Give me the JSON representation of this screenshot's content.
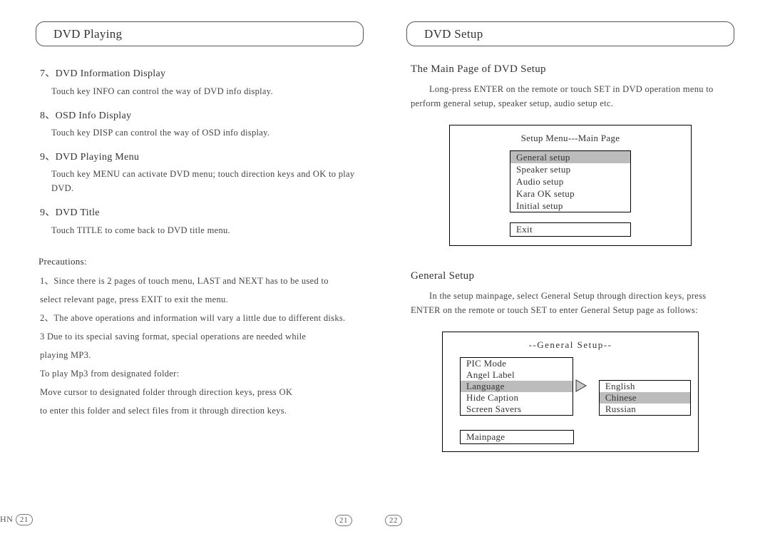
{
  "left": {
    "header": "DVD Playing",
    "items": [
      {
        "title": "7、DVD Information Display",
        "body": "Touch key INFO can control the way of DVD info display."
      },
      {
        "title": "8、OSD Info Display",
        "body": "Touch key DISP can control the way of OSD info display."
      },
      {
        "title": "9、DVD Playing Menu",
        "body": "Touch key MENU can activate DVD menu; touch direction keys and OK to play DVD."
      },
      {
        "title": "9、DVD Title",
        "body": "Touch TITLE to come back to DVD title menu."
      }
    ],
    "precautions_label": "Precautions:",
    "precautions": [
      "1、Since there is 2 pages of touch menu, LAST and NEXT has to be used to",
      "     select relevant page, press EXIT to exit the menu.",
      "2、The above operations and information will vary a little due to different disks.",
      "3    Due to its special saving format, special operations are needed while",
      "     playing MP3.",
      "     To play Mp3 from designated folder:",
      "     Move cursor to designated folder through direction keys, press OK",
      "     to enter this folder and select files from it through direction keys."
    ]
  },
  "right": {
    "header": "DVD Setup",
    "main_page": {
      "heading": "The Main Page of DVD Setup",
      "paragraph": "Long-press ENTER on the remote or touch SET in DVD operation menu to perform general setup, speaker setup, audio setup etc.",
      "menu_title": "Setup Menu---Main Page",
      "menu_items": [
        "General setup",
        "Speaker setup",
        "Audio setup",
        "Kara OK setup",
        "Initial setup"
      ],
      "menu_selected_index": 0,
      "exit_label": "Exit"
    },
    "general_setup": {
      "heading": "General Setup",
      "paragraph": "In the setup mainpage, select General Setup through direction keys, press ENTER on the remote or touch SET to enter General Setup page as follows:",
      "box_title": "--General Setup--",
      "left_items": [
        "PIC Mode",
        "Angel Label",
        "Language",
        "Hide Caption",
        "Screen Savers"
      ],
      "left_selected_index": 2,
      "right_items": [
        "English",
        "Chinese",
        "Russian"
      ],
      "right_selected_index": 1,
      "mainpage_label": "Mainpage"
    }
  },
  "footer": {
    "left_frag": "HN",
    "left_pg": "21",
    "center_left": "21",
    "center_right": "22"
  }
}
